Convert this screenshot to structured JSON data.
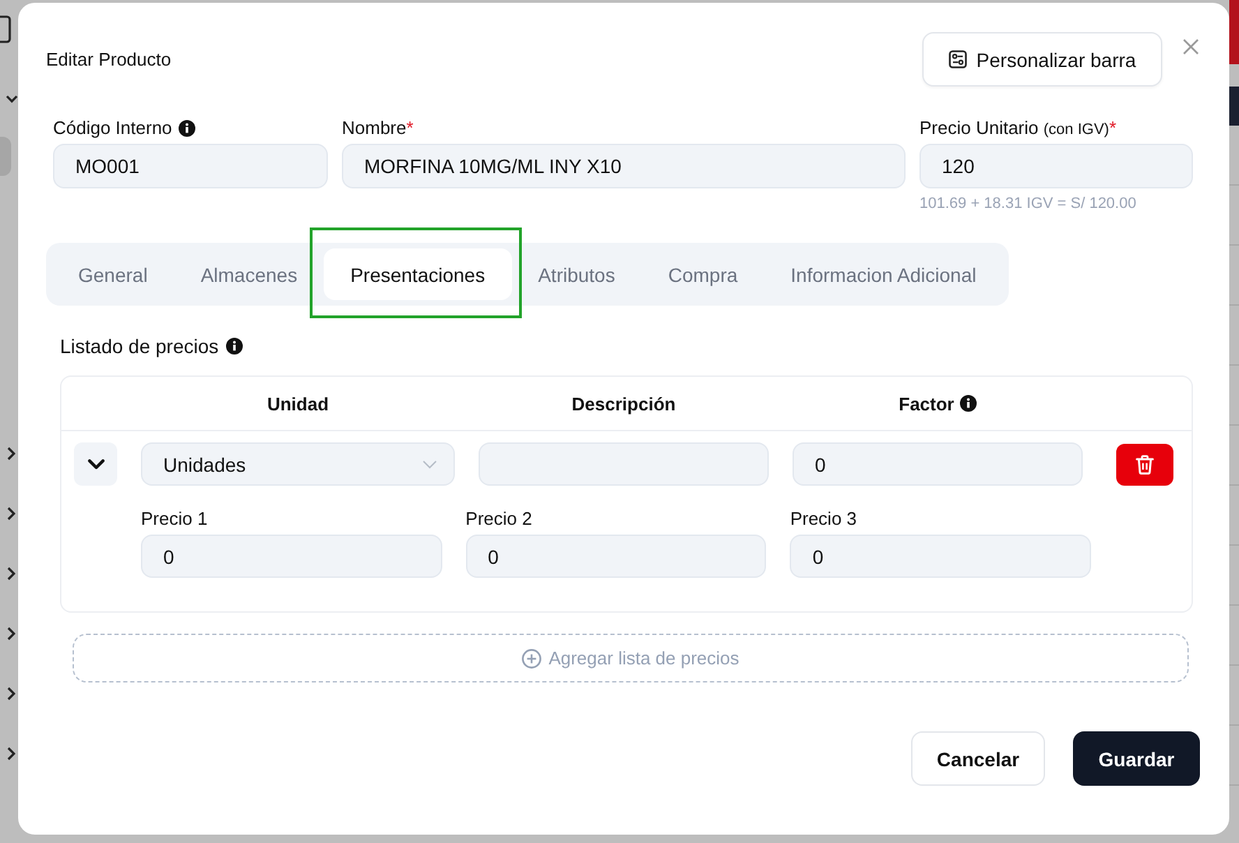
{
  "dialog": {
    "title": "Editar Producto",
    "toolbar_button": "Personalizar barra"
  },
  "fields": [
    {
      "label": "Código Interno",
      "info": true,
      "value": "MO001"
    },
    {
      "label": "Nombre",
      "info": false,
      "required_mark": "*",
      "value": "MORFINA 10MG/ML INY X10"
    },
    {
      "label": "Precio Unitario",
      "label_note": "(con IGV)",
      "info": false,
      "required_mark": "*",
      "value": "120",
      "hint": "101.69 + 18.31 IGV = S/ 120.00"
    }
  ],
  "tabs": [
    {
      "label": "General",
      "selected": false,
      "highlighted": false
    },
    {
      "label": "Almacenes",
      "selected": false,
      "highlighted": false
    },
    {
      "label": "Presentaciones",
      "selected": true,
      "highlighted": true
    },
    {
      "label": "Atributos",
      "selected": false,
      "highlighted": false
    },
    {
      "label": "Compra",
      "selected": false,
      "highlighted": false
    },
    {
      "label": "Informacion Adicional",
      "selected": false,
      "highlighted": false
    }
  ],
  "price_list": {
    "title": "Listado de precios",
    "info": true,
    "columns": [
      {
        "label": "Unidad",
        "info": false
      },
      {
        "label": "Descripción",
        "info": false
      },
      {
        "label": "Factor",
        "info": true
      }
    ],
    "rows": [
      {
        "expanded": true,
        "unit": "Unidades",
        "factor": "0",
        "prices": [
          {
            "label": "Precio 1",
            "value": "0"
          },
          {
            "label": "Precio 2",
            "value": "0"
          },
          {
            "label": "Precio 3",
            "value": "0"
          }
        ]
      }
    ],
    "add_button": "Agregar lista de precios"
  },
  "footer": {
    "buttons": [
      {
        "label": "Cancelar",
        "kind": "secondary"
      },
      {
        "label": "Guardar",
        "kind": "primary"
      }
    ]
  }
}
